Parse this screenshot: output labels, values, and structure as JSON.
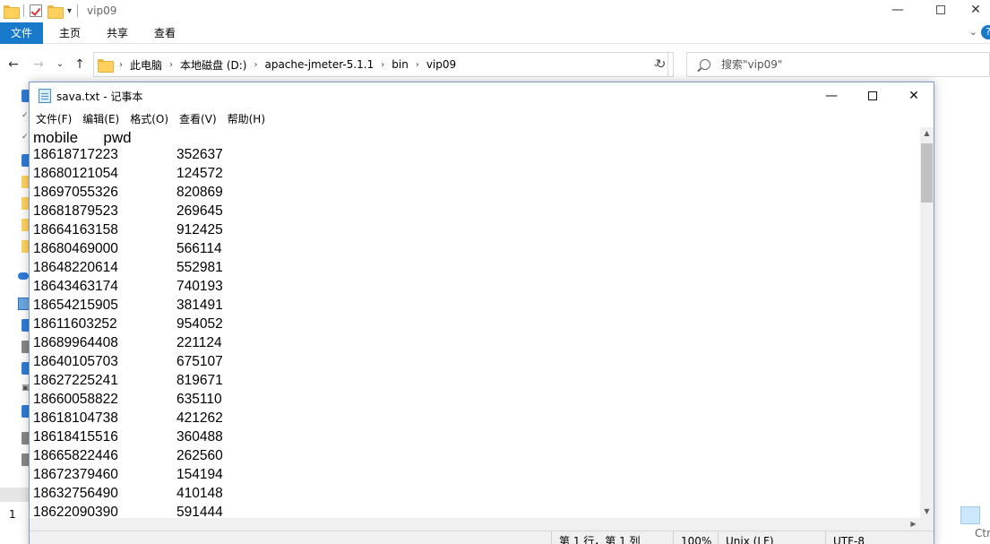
{
  "explorer": {
    "title": "vip09",
    "ribbon_tabs": [
      {
        "label": "文件",
        "active": true
      },
      {
        "label": "主页"
      },
      {
        "label": "共享"
      },
      {
        "label": "查看"
      }
    ],
    "breadcrumb": [
      "此电脑",
      "本地磁盘 (D:)",
      "apache-jmeter-5.1.1",
      "bin",
      "vip09"
    ],
    "search_placeholder": "搜索\"vip09\"",
    "status_count": "1",
    "status_right": "Ctr"
  },
  "notepad": {
    "title": "sava.txt - 记事本",
    "menu": [
      "文件(F)",
      "编辑(E)",
      "格式(O)",
      "查看(V)",
      "帮助(H)"
    ],
    "header_line": "mobile      pwd",
    "rows": [
      {
        "mobile": "18618717223",
        "pwd": "352637"
      },
      {
        "mobile": "18680121054",
        "pwd": "124572"
      },
      {
        "mobile": "18697055326",
        "pwd": "820869"
      },
      {
        "mobile": "18681879523",
        "pwd": "269645"
      },
      {
        "mobile": "18664163158",
        "pwd": "912425"
      },
      {
        "mobile": "18680469000",
        "pwd": "566114"
      },
      {
        "mobile": "18648220614",
        "pwd": "552981"
      },
      {
        "mobile": "18643463174",
        "pwd": "740193"
      },
      {
        "mobile": "18654215905",
        "pwd": "381491"
      },
      {
        "mobile": "18611603252",
        "pwd": "954052"
      },
      {
        "mobile": "18689964408",
        "pwd": "221124"
      },
      {
        "mobile": "18640105703",
        "pwd": "675107"
      },
      {
        "mobile": "18627225241",
        "pwd": "819671"
      },
      {
        "mobile": "18660058822",
        "pwd": "635110"
      },
      {
        "mobile": "18618104738",
        "pwd": "421262"
      },
      {
        "mobile": "18618415516",
        "pwd": "360488"
      },
      {
        "mobile": "18665822446",
        "pwd": "262560"
      },
      {
        "mobile": "18672379460",
        "pwd": "154194"
      },
      {
        "mobile": "18632756490",
        "pwd": "410148"
      },
      {
        "mobile": "18622090390",
        "pwd": "591444"
      }
    ],
    "status": {
      "position": "第 1 行，第 1 列",
      "zoom": "100%",
      "line_ending": "Unix (LF)",
      "encoding": "UTF-8"
    }
  }
}
